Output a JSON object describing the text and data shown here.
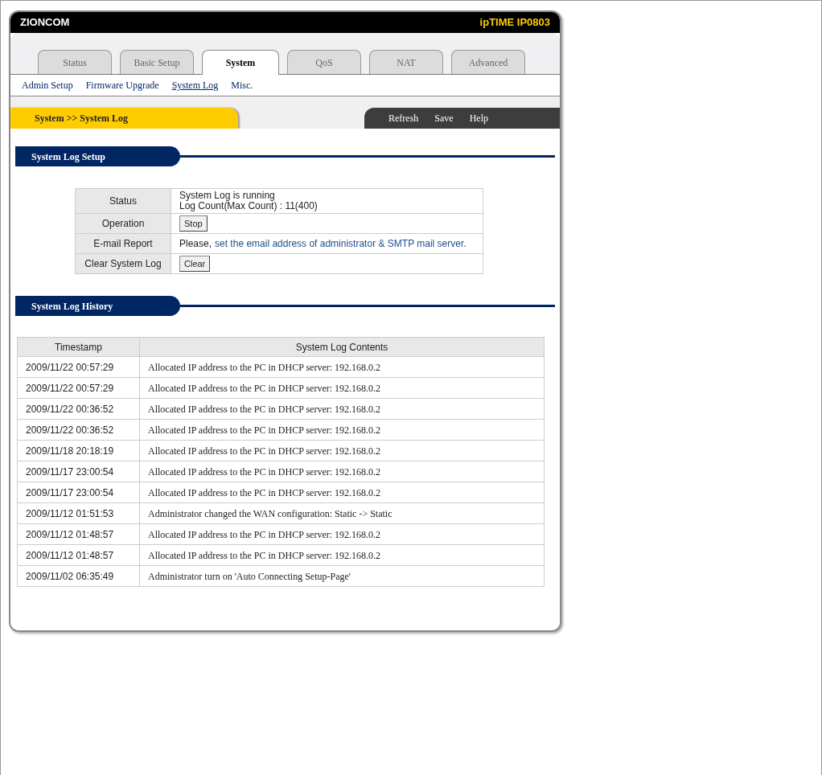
{
  "header": {
    "brand": "ZIONCOM",
    "model": "ipTIME IP0803"
  },
  "tabs": [
    {
      "label": "Status",
      "selected": false
    },
    {
      "label": "Basic Setup",
      "selected": false
    },
    {
      "label": "System",
      "selected": true
    },
    {
      "label": "QoS",
      "selected": false
    },
    {
      "label": "NAT",
      "selected": false
    },
    {
      "label": "Advanced",
      "selected": false
    }
  ],
  "subnav": [
    {
      "label": "Admin Setup",
      "selected": false
    },
    {
      "label": "Firmware Upgrade",
      "selected": false
    },
    {
      "label": "System Log",
      "selected": true
    },
    {
      "label": "Misc.",
      "selected": false
    }
  ],
  "breadcrumb": "System >> System Log",
  "actions": [
    "Refresh",
    "Save",
    "Help"
  ],
  "setup": {
    "title": "System Log Setup",
    "rows": [
      {
        "kind": "lines",
        "label": "Status",
        "lines": [
          "System Log is running",
          "Log Count(Max Count) : 11(400)"
        ]
      },
      {
        "kind": "button",
        "label": "Operation",
        "button": "Stop"
      },
      {
        "kind": "link",
        "label": "E-mail Report",
        "prefix": "Please,",
        "link": "set the email address of administrator & SMTP mail server."
      },
      {
        "kind": "button",
        "label": "Clear System Log",
        "button": "Clear"
      }
    ]
  },
  "history": {
    "title": "System Log History",
    "columns": [
      "Timestamp",
      "System Log Contents"
    ],
    "rows": [
      [
        "2009/11/22 00:57:29",
        "Allocated IP address to the PC in DHCP server: 192.168.0.2"
      ],
      [
        "2009/11/22 00:57:29",
        "Allocated IP address to the PC in DHCP server: 192.168.0.2"
      ],
      [
        "2009/11/22 00:36:52",
        "Allocated IP address to the PC in DHCP server: 192.168.0.2"
      ],
      [
        "2009/11/22 00:36:52",
        "Allocated IP address to the PC in DHCP server: 192.168.0.2"
      ],
      [
        "2009/11/18 20:18:19",
        "Allocated IP address to the PC in DHCP server: 192.168.0.2"
      ],
      [
        "2009/11/17 23:00:54",
        "Allocated IP address to the PC in DHCP server: 192.168.0.2"
      ],
      [
        "2009/11/17 23:00:54",
        "Allocated IP address to the PC in DHCP server: 192.168.0.2"
      ],
      [
        "2009/11/12 01:51:53",
        "Administrator changed the WAN configuration: Static -> Static"
      ],
      [
        "2009/11/12 01:48:57",
        "Allocated IP address to the PC in DHCP server: 192.168.0.2"
      ],
      [
        "2009/11/12 01:48:57",
        "Allocated IP address to the PC in DHCP server: 192.168.0.2"
      ],
      [
        "2009/11/02 06:35:49",
        "Administrator turn on 'Auto Connecting Setup-Page'"
      ]
    ]
  }
}
